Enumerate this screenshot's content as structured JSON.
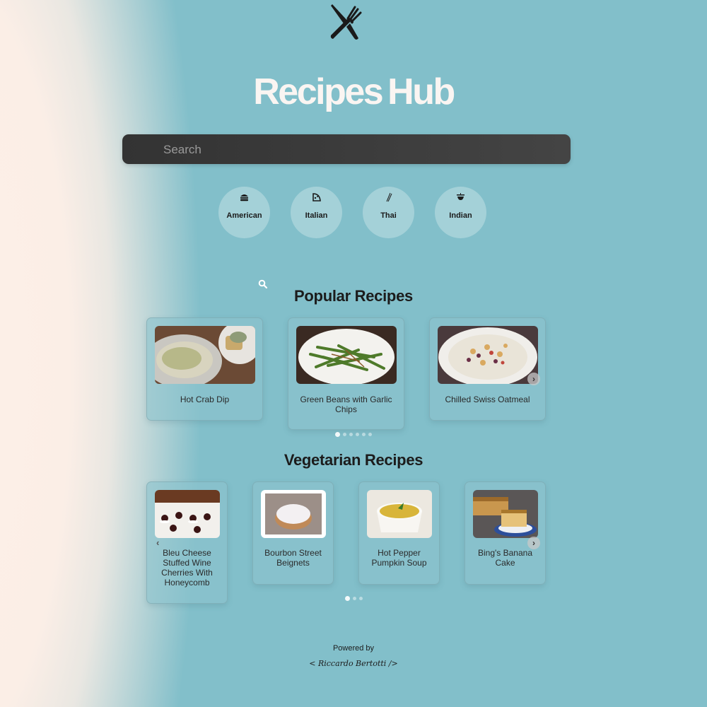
{
  "app": {
    "title": "Recipes Hub"
  },
  "search": {
    "placeholder": "Search"
  },
  "categories": [
    {
      "label": "American",
      "icon": "burger-icon"
    },
    {
      "label": "Italian",
      "icon": "pizza-icon"
    },
    {
      "label": "Thai",
      "icon": "chopsticks-icon"
    },
    {
      "label": "Indian",
      "icon": "bowl-icon"
    }
  ],
  "popular": {
    "title": "Popular Recipes",
    "items": [
      {
        "name": "Hot Crab Dip"
      },
      {
        "name": "Green Beans with Garlic Chips"
      },
      {
        "name": "Chilled Swiss Oatmeal"
      }
    ],
    "page_count": 6,
    "active_page": 1
  },
  "vegetarian": {
    "title": "Vegetarian Recipes",
    "items": [
      {
        "name": "Bleu Cheese Stuffed Wine Cherries With Honeycomb"
      },
      {
        "name": "Bourbon Street Beignets"
      },
      {
        "name": "Hot Pepper Pumpkin Soup"
      },
      {
        "name": "Bing's Banana Cake"
      }
    ],
    "page_count": 3,
    "active_page": 1
  },
  "footer": {
    "powered_by": "Powered by",
    "signature": "< Riccardo Bertotti />"
  },
  "colors": {
    "background": "#82bfca",
    "search_bar": "#3a3a3a",
    "title": "#faf5f2"
  }
}
